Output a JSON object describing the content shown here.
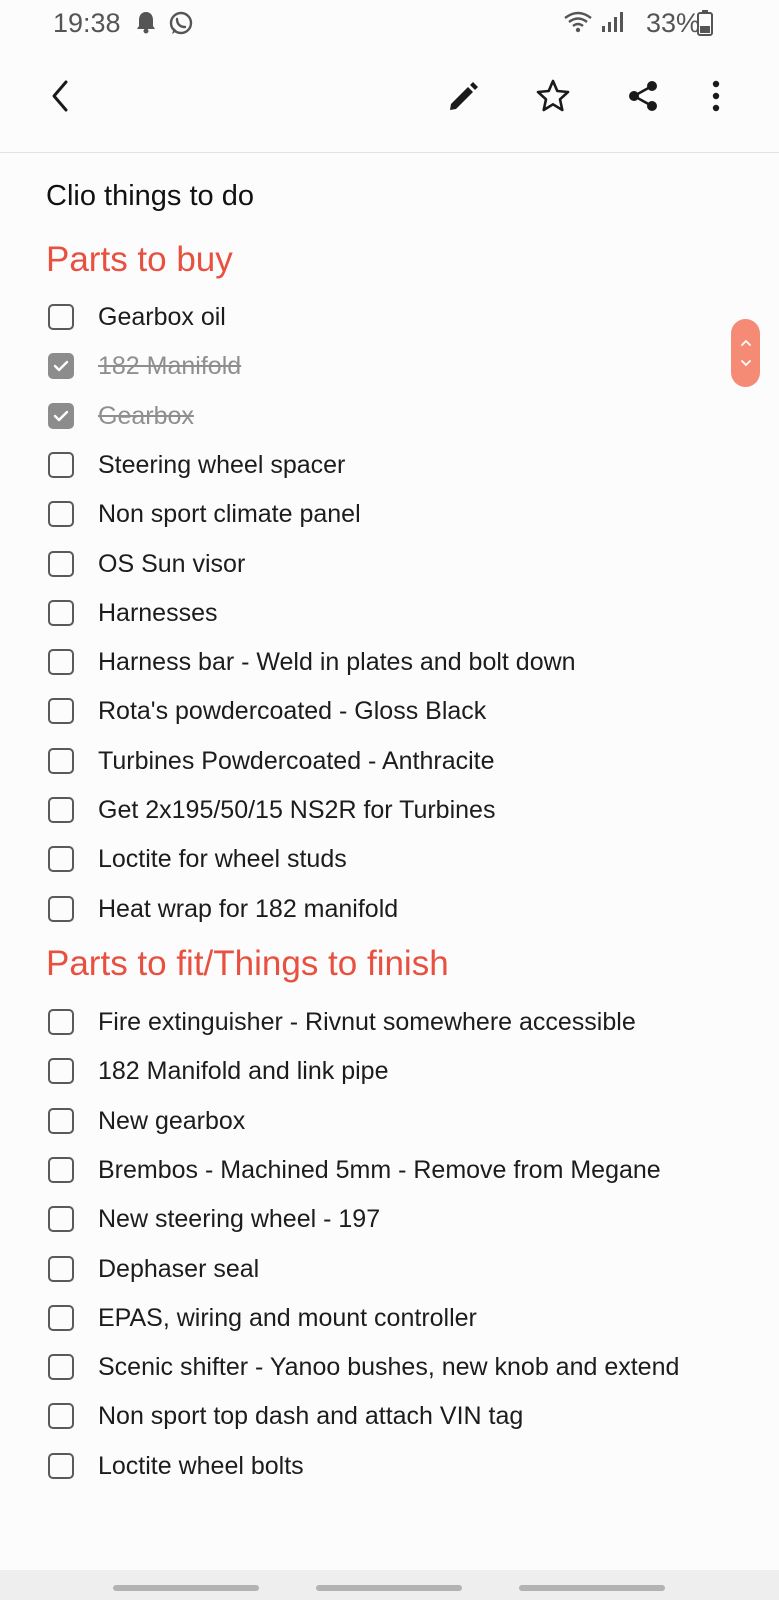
{
  "status_bar": {
    "time": "19:38",
    "icons": [
      "bell-icon",
      "whatsapp-icon",
      "wifi-icon",
      "signal-icon",
      "battery-icon"
    ],
    "battery": "33%"
  },
  "toolbar": {
    "icons": [
      "back-icon",
      "edit-icon",
      "star-icon",
      "share-icon",
      "more-icon"
    ]
  },
  "note": {
    "title": "Clio things to do",
    "sections": [
      {
        "heading": "Parts to buy",
        "items": [
          {
            "text": "Gearbox oil",
            "checked": false
          },
          {
            "text": "182 Manifold",
            "checked": true
          },
          {
            "text": "Gearbox",
            "checked": true
          },
          {
            "text": "Steering wheel spacer",
            "checked": false
          },
          {
            "text": "Non sport climate panel",
            "checked": false
          },
          {
            "text": "OS Sun visor",
            "checked": false
          },
          {
            "text": "Harnesses",
            "checked": false
          },
          {
            "text": "Harness bar - Weld in plates and bolt down",
            "checked": false
          },
          {
            "text": "Rota's powdercoated - Gloss Black",
            "checked": false
          },
          {
            "text": "Turbines Powdercoated - Anthracite",
            "checked": false
          },
          {
            "text": "Get 2x195/50/15 NS2R for Turbines",
            "checked": false
          },
          {
            "text": "Loctite for wheel studs",
            "checked": false
          },
          {
            "text": "Heat wrap for 182 manifold",
            "checked": false
          }
        ]
      },
      {
        "heading": "Parts to fit/Things to finish",
        "items": [
          {
            "text": "Fire extinguisher - Rivnut somewhere accessible",
            "checked": false
          },
          {
            "text": "182 Manifold and link pipe",
            "checked": false
          },
          {
            "text": "New gearbox",
            "checked": false
          },
          {
            "text": "Brembos - Machined 5mm - Remove from Megane",
            "checked": false
          },
          {
            "text": "New steering wheel - 197",
            "checked": false
          },
          {
            "text": "Dephaser seal",
            "checked": false
          },
          {
            "text": "EPAS, wiring and mount controller",
            "checked": false
          },
          {
            "text": "Scenic shifter - Yanoo bushes, new knob and extend",
            "checked": false
          },
          {
            "text": "Non sport top dash and attach VIN tag",
            "checked": false
          },
          {
            "text": "Loctite wheel bolts",
            "checked": false
          }
        ]
      }
    ]
  },
  "colors": {
    "heading": "#e8503f",
    "scroll_handle": "#f58b75",
    "checked_box": "#8c8c8c"
  }
}
